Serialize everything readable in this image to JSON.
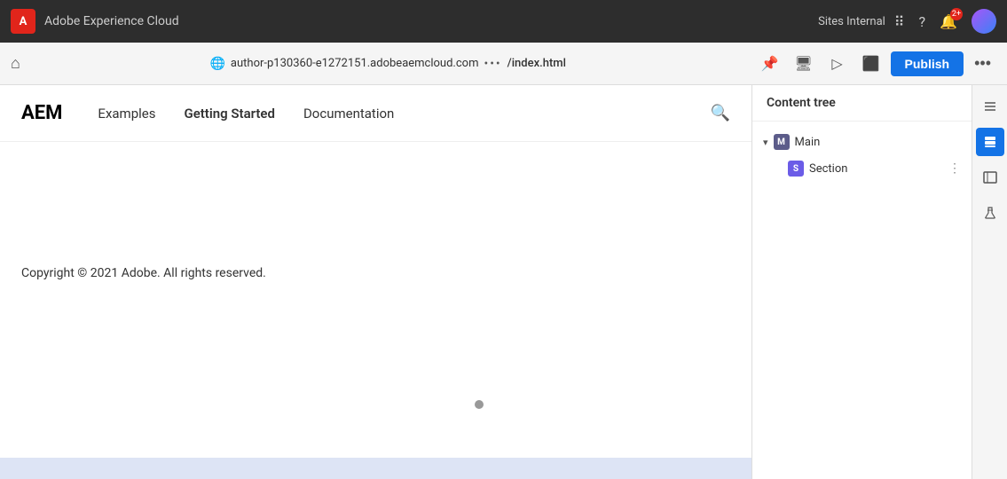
{
  "topbar": {
    "adobe_logo": "A",
    "app_name": "Adobe Experience Cloud",
    "sites_label": "Sites Internal",
    "notification_count": "2+",
    "waffle_icon": "⋮⋮⋮",
    "help_icon": "?",
    "notif_icon": "🔔"
  },
  "addressbar": {
    "url_globe": "🌐",
    "url_text": "author-p130360-e1272151.adobeaemcloud.com",
    "url_dots": "•••",
    "url_path": "/index.html",
    "pin_icon": "📌",
    "desktop_icon": "🖥",
    "monitor_icon": "▷",
    "tablet_icon": "⬜",
    "publish_label": "Publish",
    "more_icon": "•••"
  },
  "nav": {
    "logo": "AEM",
    "links": [
      {
        "label": "Examples"
      },
      {
        "label": "Getting Started"
      },
      {
        "label": "Documentation"
      }
    ],
    "search_icon": "🔍"
  },
  "page": {
    "copyright": "Copyright © 2021 Adobe. All rights reserved."
  },
  "right_panel": {
    "header": "Content tree",
    "tree": {
      "main_label": "Main",
      "section_label": "Section"
    }
  },
  "sidetoolbar": {
    "tools": [
      {
        "name": "filter-icon",
        "symbol": "≡",
        "active": false
      },
      {
        "name": "layers-icon",
        "symbol": "▤",
        "active": true
      },
      {
        "name": "properties-icon",
        "symbol": "▭",
        "active": false
      },
      {
        "name": "flask-icon",
        "symbol": "⚗",
        "active": false
      }
    ]
  }
}
